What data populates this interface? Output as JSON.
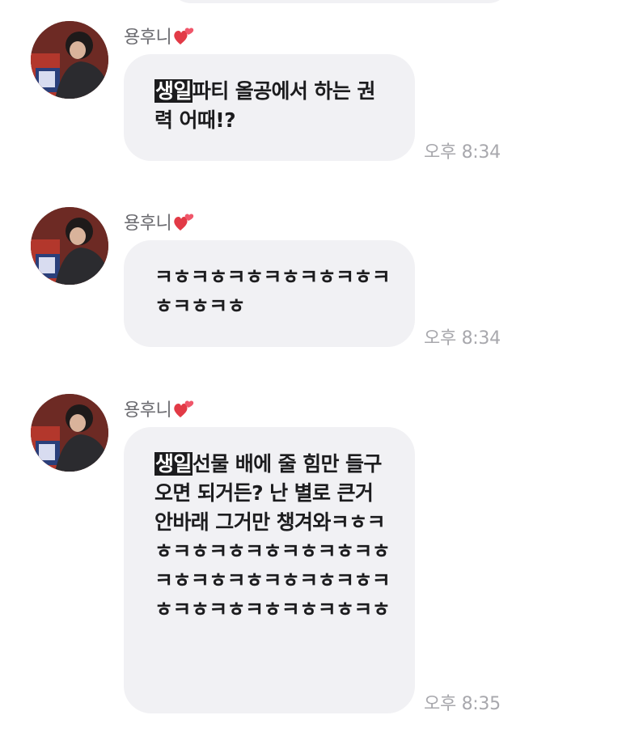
{
  "conversation": {
    "messages": [
      {
        "sender": "용후니",
        "highlight": "생일",
        "text": "파티 올공에서 하는 권력 어때!?",
        "time": "오후 8:34"
      },
      {
        "sender": "용후니",
        "highlight": "",
        "text": "ㅋㅎㅋㅎㅋㅎㅋㅎㅋㅎㅋㅎㅋㅎㅋㅎㅋㅎ",
        "time": "오후 8:34"
      },
      {
        "sender": "용후니",
        "highlight": "생일",
        "text": "선물 배에 줄 힘만 들구오면 되거든? 난 별로 큰거 안바래 그거만 챙겨와ㅋㅎㅋㅎㅋㅎㅋㅎㅋㅎㅋㅎㅋㅎㅋㅎㅋㅎㅋㅎㅋㅎㅋㅎㅋㅎㅋㅎㅋㅎㅋㅎㅋㅎㅋㅎㅋㅎㅋㅎㅋㅎ",
        "time": "오후 8:35"
      }
    ]
  },
  "icons": {
    "sender_badge": "heart-emoji-icon",
    "avatar": "profile-photo"
  },
  "colors": {
    "bubble": "#f1f1f4",
    "highlight_bg": "#1c1c1e",
    "time_text": "#a8a8ad",
    "name_text": "#6b6b70"
  }
}
